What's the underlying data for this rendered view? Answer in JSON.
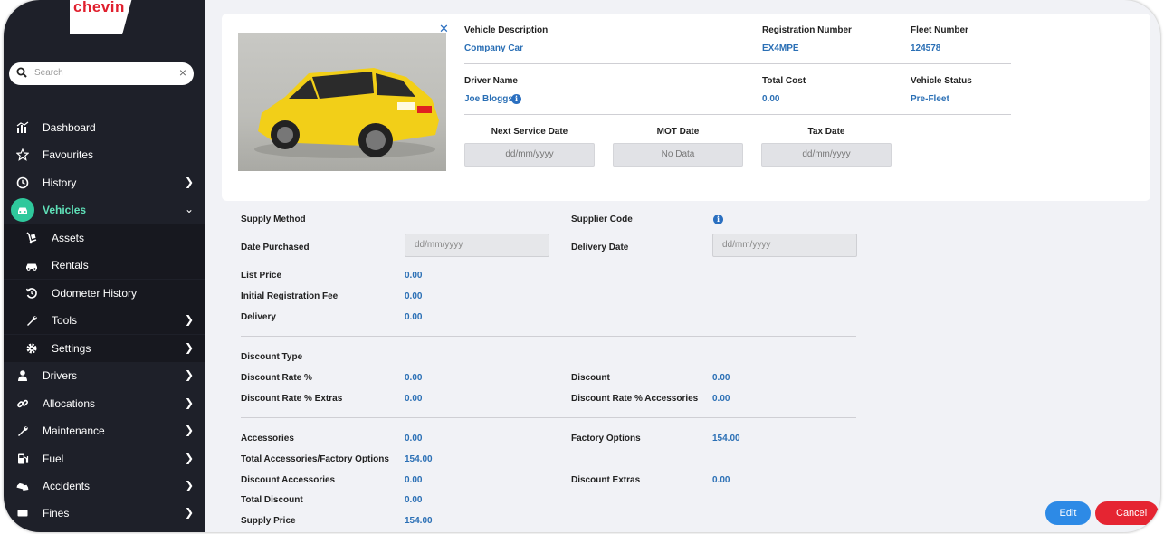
{
  "brand": {
    "logo_text": "chevin",
    "logo_color": "#e0202e"
  },
  "search": {
    "placeholder": "Search"
  },
  "sidebar": {
    "items": [
      {
        "label": "Dashboard",
        "icon": "chart-icon"
      },
      {
        "label": "Favourites",
        "icon": "star-icon"
      },
      {
        "label": "History",
        "icon": "clock-icon"
      },
      {
        "label": "Vehicles",
        "icon": "car-icon",
        "active": true
      },
      {
        "label": "Assets",
        "icon": "trolley-icon"
      },
      {
        "label": "Rentals",
        "icon": "car-small-icon"
      },
      {
        "label": "Odometer History",
        "icon": "history-icon"
      },
      {
        "label": "Tools",
        "icon": "wrench-icon"
      },
      {
        "label": "Settings",
        "icon": "gear-icon"
      },
      {
        "label": "Drivers",
        "icon": "user-icon"
      },
      {
        "label": "Allocations",
        "icon": "link-icon"
      },
      {
        "label": "Maintenance",
        "icon": "wrench-icon"
      },
      {
        "label": "Fuel",
        "icon": "fuel-icon"
      },
      {
        "label": "Accidents",
        "icon": "crash-icon"
      },
      {
        "label": "Fines",
        "icon": "ticket-icon"
      }
    ],
    "accent_color": "#2fc89c"
  },
  "header_card": {
    "vehicle_description": {
      "label": "Vehicle Description",
      "value": "Company Car"
    },
    "registration_number": {
      "label": "Registration Number",
      "value": "EX4MPE"
    },
    "fleet_number": {
      "label": "Fleet Number",
      "value": "124578"
    },
    "driver_name": {
      "label": "Driver Name",
      "value": "Joe Bloggs"
    },
    "total_cost": {
      "label": "Total Cost",
      "value": "0.00"
    },
    "vehicle_status": {
      "label": "Vehicle Status",
      "value": "Pre-Fleet"
    },
    "next_service_date": {
      "label": "Next Service Date",
      "value": "dd/mm/yyyy"
    },
    "mot_date": {
      "label": "MOT Date",
      "value": "No Data"
    },
    "tax_date": {
      "label": "Tax Date",
      "value": "dd/mm/yyyy"
    }
  },
  "supply": {
    "supply_method": {
      "label": "Supply Method"
    },
    "supplier_code": {
      "label": "Supplier Code"
    },
    "date_purchased": {
      "label": "Date Purchased",
      "placeholder": "dd/mm/yyyy"
    },
    "delivery_date": {
      "label": "Delivery Date",
      "placeholder": "dd/mm/yyyy"
    },
    "list_price": {
      "label": "List Price",
      "value": "0.00"
    },
    "initial_registration_fee": {
      "label": "Initial Registration Fee",
      "value": "0.00"
    },
    "delivery": {
      "label": "Delivery",
      "value": "0.00"
    },
    "discount_type": {
      "label": "Discount Type"
    },
    "discount_rate": {
      "label": "Discount Rate %",
      "value": "0.00"
    },
    "discount": {
      "label": "Discount",
      "value": "0.00"
    },
    "discount_rate_extras": {
      "label": "Discount Rate % Extras",
      "value": "0.00"
    },
    "discount_rate_accessories": {
      "label": "Discount Rate % Accessories",
      "value": "0.00"
    },
    "accessories": {
      "label": "Accessories",
      "value": "0.00"
    },
    "factory_options": {
      "label": "Factory Options",
      "value": "154.00"
    },
    "total_accessories_factory": {
      "label": "Total Accessories/Factory Options",
      "value": "154.00"
    },
    "discount_accessories": {
      "label": "Discount Accessories",
      "value": "0.00"
    },
    "discount_extras": {
      "label": "Discount Extras",
      "value": "0.00"
    },
    "total_discount": {
      "label": "Total Discount",
      "value": "0.00"
    },
    "supply_price": {
      "label": "Supply Price",
      "value": "154.00"
    }
  },
  "actions": {
    "edit_label": "Edit",
    "cancel_label": "Cancel"
  }
}
